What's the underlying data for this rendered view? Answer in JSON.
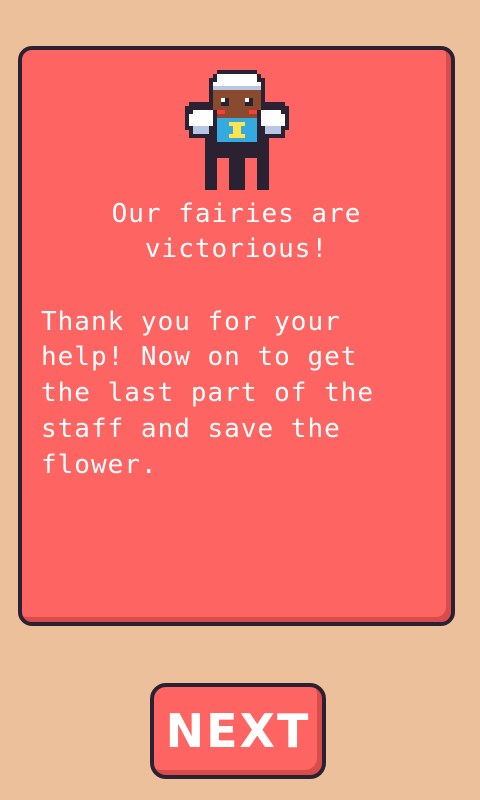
{
  "dialog": {
    "headline_line1": "Our fairies are",
    "headline_line2": "victorious!",
    "message_lines": [
      "Thank you for your",
      "help! Now on to get",
      "the last part of the",
      "staff and save the",
      "flower."
    ]
  },
  "next_button": {
    "label": "NEXT"
  },
  "colors": {
    "background": "#ecc09a",
    "panel": "#fe6462",
    "outline": "#2a2233",
    "text": "#ffffff"
  },
  "icons": {
    "sprite": "fairy-character-icon"
  }
}
